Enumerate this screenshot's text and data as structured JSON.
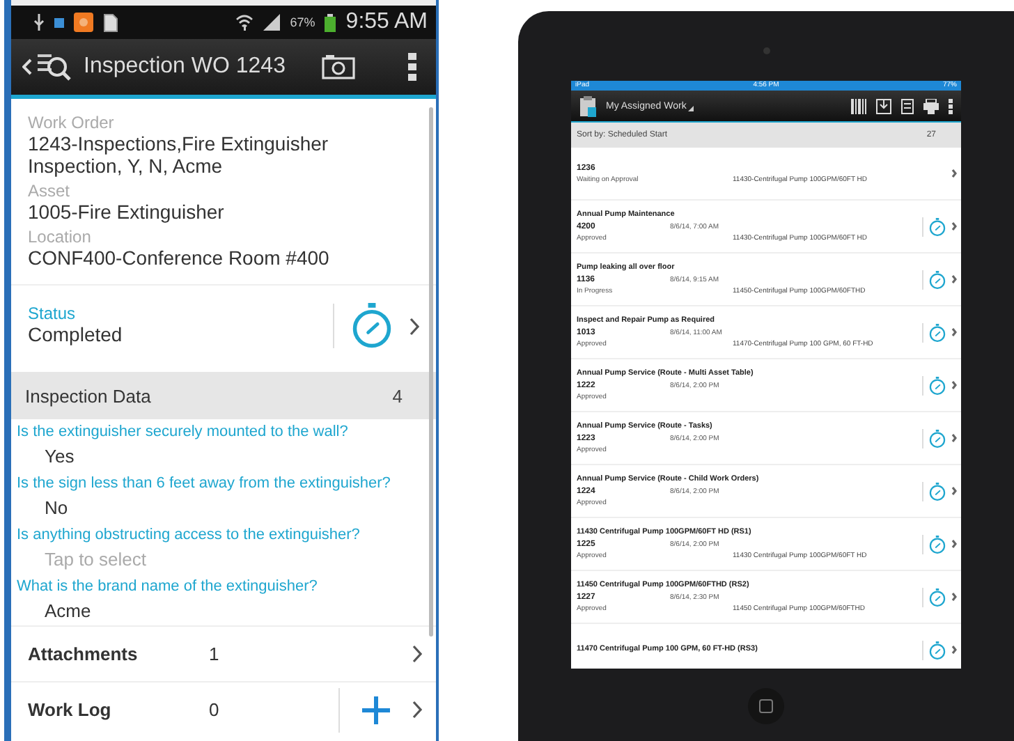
{
  "phone": {
    "status_bar": {
      "battery": "67%",
      "time": "9:55 AM"
    },
    "header": {
      "title": "Inspection WO 1243"
    },
    "fields": [
      {
        "label": "Work Order",
        "value": "1243-Inspections,Fire Extinguisher Inspection, Y, N, Acme"
      },
      {
        "label": "Asset",
        "value": "1005-Fire Extinguisher"
      },
      {
        "label": "Location",
        "value": "CONF400-Conference Room #400"
      }
    ],
    "status": {
      "label": "Status",
      "value": "Completed"
    },
    "inspection_data": {
      "title": "Inspection Data",
      "count": "4",
      "questions": [
        {
          "question": "Is the extinguisher securely mounted to the wall?",
          "answer": "Yes"
        },
        {
          "question": "Is the sign less than 6 feet away from the extinguisher?",
          "answer": "No"
        },
        {
          "question": "Is anything obstructing access to the extinguisher?",
          "placeholder": "Tap to select"
        },
        {
          "question": "What is the brand name of the extinguisher?",
          "answer": "Acme"
        }
      ]
    },
    "rows": [
      {
        "kind": "link",
        "label": "Attachments",
        "count": "1"
      },
      {
        "kind": "add",
        "label": "Work Log",
        "count": "0"
      }
    ]
  },
  "tablet": {
    "status_bar": {
      "carrier": "iPad",
      "time": "4:56 PM",
      "battery": "77%"
    },
    "header": {
      "title": "My Assigned Work"
    },
    "sort": {
      "label": "Sort by: Scheduled Start",
      "count": "27"
    },
    "work_orders": [
      {
        "number": "1236",
        "status": "Waiting on Approval",
        "asset": "11430-Centrifugal Pump 100GPM/60FT HD",
        "timer": false
      },
      {
        "title": "Annual Pump Maintenance",
        "number": "4200",
        "date": "8/6/14, 7:00 AM",
        "status": "Approved",
        "asset": "11430-Centrifugal Pump 100GPM/60FT HD",
        "timer": true
      },
      {
        "title": "Pump leaking all over floor",
        "number": "1136",
        "date": "8/6/14, 9:15 AM",
        "status": "In Progress",
        "asset": "11450-Centrifugal Pump 100GPM/60FTHD",
        "timer": true
      },
      {
        "title": "Inspect and Repair Pump as Required",
        "number": "1013",
        "date": "8/6/14, 11:00 AM",
        "status": "Approved",
        "asset": "11470-Centrifugal Pump 100 GPM, 60 FT-HD",
        "timer": true
      },
      {
        "title": "Annual Pump Service (Route - Multi Asset Table)",
        "number": "1222",
        "date": "8/6/14, 2:00 PM",
        "status": "Approved",
        "timer": true
      },
      {
        "title": "Annual Pump Service (Route - Tasks)",
        "number": "1223",
        "date": "8/6/14, 2:00 PM",
        "status": "Approved",
        "timer": true
      },
      {
        "title": "Annual Pump Service (Route - Child Work Orders)",
        "number": "1224",
        "date": "8/6/14, 2:00 PM",
        "status": "Approved",
        "timer": true
      },
      {
        "title": "11430 Centrifugal Pump 100GPM/60FT HD (RS1)",
        "number": "1225",
        "date": "8/6/14, 2:00 PM",
        "status": "Approved",
        "asset": "11430 Centrifugal Pump 100GPM/60FT HD",
        "timer": true
      },
      {
        "title": "11450 Centrifugal Pump 100GPM/60FTHD (RS2)",
        "number": "1227",
        "date": "8/6/14, 2:30 PM",
        "status": "Approved",
        "asset": "11450 Centrifugal Pump 100GPM/60FTHD",
        "timer": true
      },
      {
        "title": "11470 Centrifugal Pump 100 GPM, 60 FT-HD (RS3)",
        "timer": true
      }
    ]
  }
}
